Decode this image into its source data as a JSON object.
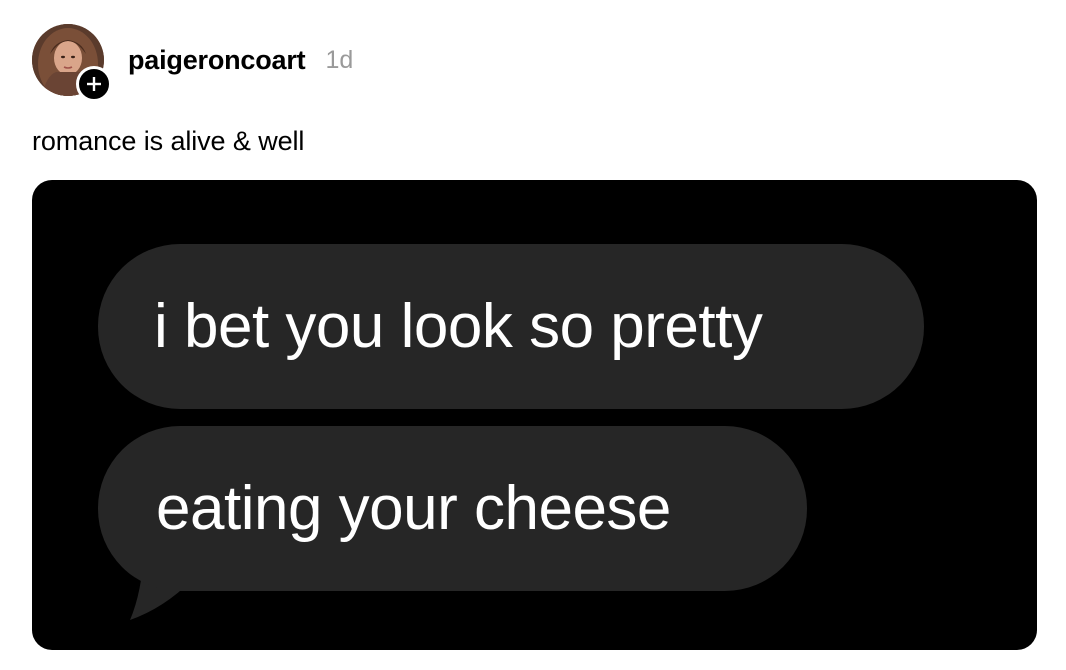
{
  "post": {
    "username": "paigeroncoart",
    "timestamp": "1d",
    "caption": "romance is alive & well"
  },
  "icons": {
    "avatar": "profile-photo",
    "follow_badge": "plus-icon"
  },
  "colors": {
    "background": "#ffffff",
    "timestamp": "#9a9a9a",
    "media_background": "#000000",
    "bubble": "#262626",
    "bubble_text": "#ffffff",
    "badge": "#000000"
  },
  "media": {
    "messages": [
      "i bet you look so pretty",
      "eating your cheese"
    ]
  }
}
